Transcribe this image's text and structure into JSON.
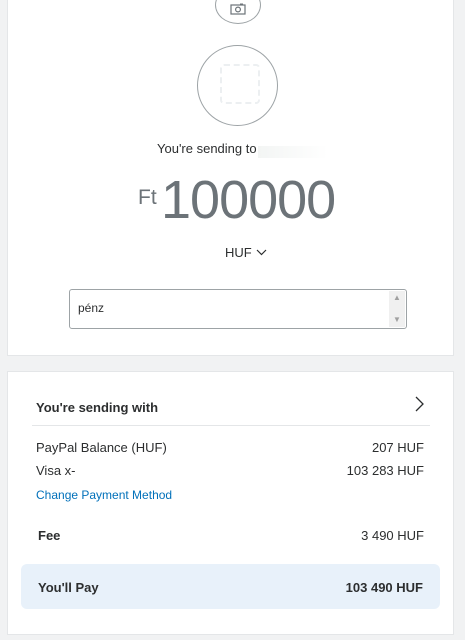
{
  "header": {
    "camera_icon": "camera-icon",
    "avatar_icon": "avatar-icon",
    "sending_to_label": "You're sending to"
  },
  "amount": {
    "currency_symbol": "Ft",
    "value": "100000",
    "currency_code": "HUF"
  },
  "note": {
    "value": "pénz"
  },
  "payment": {
    "sending_with_label": "You're sending with",
    "sources": [
      {
        "label": "PayPal Balance (HUF)",
        "amount": "207 HUF"
      },
      {
        "label": "Visa x-",
        "amount": "103 283 HUF"
      }
    ],
    "change_link": "Change Payment Method",
    "fee_label": "Fee",
    "fee_amount": "3 490 HUF",
    "total_label": "You'll Pay",
    "total_amount": "103 490 HUF"
  },
  "colors": {
    "link": "#0070ba",
    "total_bg": "#e8f1fa",
    "amount_text": "#6c7378"
  }
}
